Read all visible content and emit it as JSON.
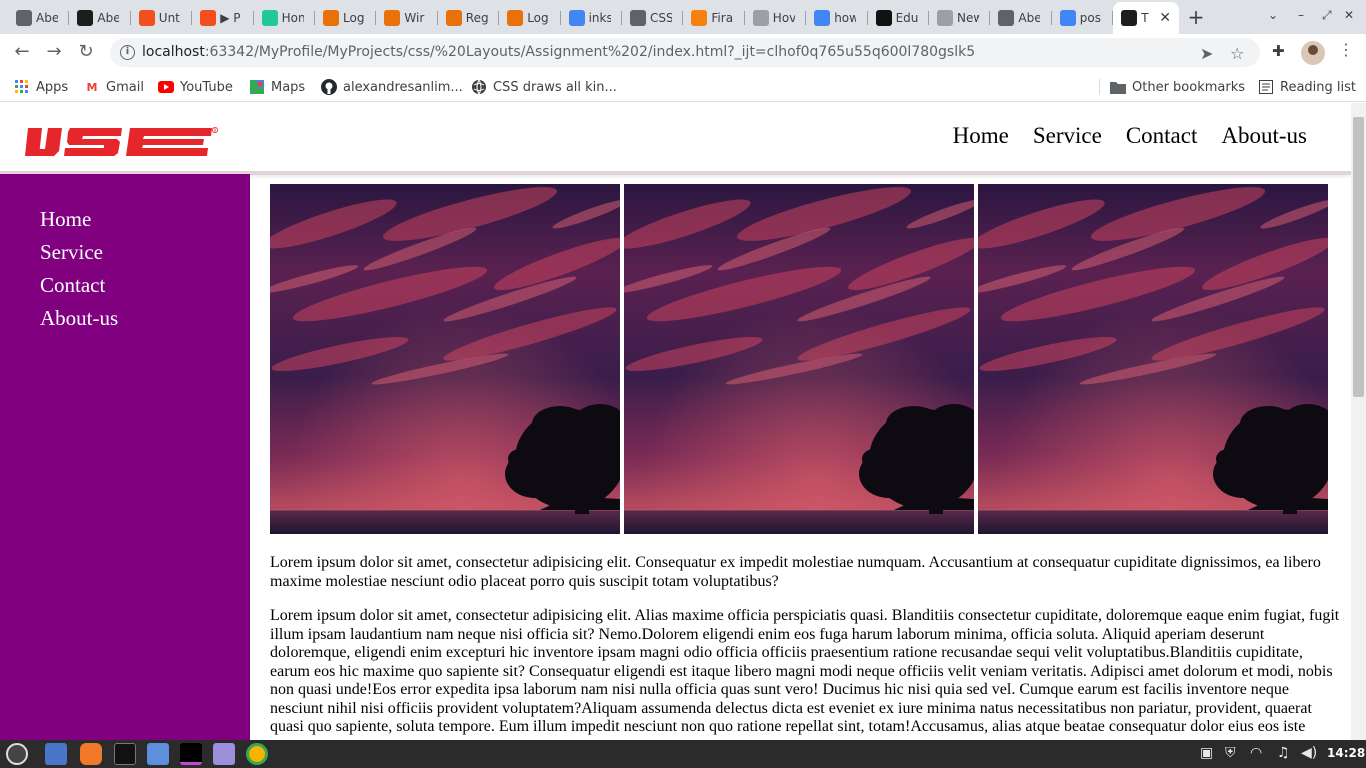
{
  "browser": {
    "tabs": [
      {
        "label": "Abe",
        "icon": "globe-icon",
        "color": "#5f6368"
      },
      {
        "label": "Abe",
        "icon": "intellij-icon",
        "color": "#1d1d1d"
      },
      {
        "label": "Unt",
        "icon": "figma-icon",
        "color": "#f24e1e"
      },
      {
        "label": "▶ P",
        "icon": "figma-icon",
        "color": "#f24e1e"
      },
      {
        "label": "Hon",
        "icon": "app-icon",
        "color": "#20c997"
      },
      {
        "label": "Log",
        "icon": "page-icon",
        "color": "#e8710a"
      },
      {
        "label": "Wir",
        "icon": "page-icon",
        "color": "#e8710a"
      },
      {
        "label": "Reg",
        "icon": "page-icon",
        "color": "#e8710a"
      },
      {
        "label": "Log",
        "icon": "page-icon",
        "color": "#e8710a"
      },
      {
        "label": "inks",
        "icon": "google-icon",
        "color": "#4285f4"
      },
      {
        "label": "CSS",
        "icon": "globe-icon",
        "color": "#5f6368"
      },
      {
        "label": "Fira",
        "icon": "firebase-icon",
        "color": "#f6820d"
      },
      {
        "label": "Hov",
        "icon": "code-icon",
        "color": "#9aa0a6"
      },
      {
        "label": "how",
        "icon": "google-icon",
        "color": "#4285f4"
      },
      {
        "label": "Edu",
        "icon": "unsplash-icon",
        "color": "#111111"
      },
      {
        "label": "New",
        "icon": "globe-icon",
        "color": "#9aa0a6"
      },
      {
        "label": "Abe",
        "icon": "globe-icon",
        "color": "#5f6368"
      },
      {
        "label": "pos",
        "icon": "google-icon",
        "color": "#4285f4"
      },
      {
        "label": "T",
        "icon": "intellij-icon",
        "color": "#1d1d1d",
        "active": true
      }
    ],
    "new_tab": "+",
    "close": "✕",
    "url_host": "localhost",
    "url_rest": ":63342/MyProfile/MyProjects/css/%20Layouts/Assignment%202/index.html?_ijt=clhof0q765u55q600l780gslk5",
    "bookmarks": [
      {
        "label": "Apps",
        "icon": "apps-grid-icon"
      },
      {
        "label": "Gmail",
        "icon": "gmail-icon"
      },
      {
        "label": "YouTube",
        "icon": "youtube-icon"
      },
      {
        "label": "Maps",
        "icon": "maps-icon"
      },
      {
        "label": "alexandresanlim...",
        "icon": "github-icon"
      },
      {
        "label": "CSS draws all kin...",
        "icon": "globe-icon"
      }
    ],
    "other_bookmarks": "Other bookmarks",
    "reading_list": "Reading list"
  },
  "site": {
    "logo_text": "IJSE",
    "brand_color": "#e5262a",
    "sidebar_color": "#800080",
    "nav": [
      "Home",
      "Service",
      "Contact",
      "About-us"
    ],
    "sidebar_nav": [
      "Home",
      "Service",
      "Contact",
      "About-us"
    ],
    "paragraphs": [
      "Lorem ipsum dolor sit amet, consectetur adipisicing elit. Consequatur ex impedit molestiae numquam. Accusantium at consequatur cupiditate dignissimos, ea libero maxime molestiae nesciunt odio placeat porro quis suscipit totam voluptatibus?",
      "Lorem ipsum dolor sit amet, consectetur adipisicing elit. Alias maxime officia perspiciatis quasi. Blanditiis consectetur cupiditate, doloremque eaque enim fugiat, fugit illum ipsam laudantium nam neque nisi officia sit? Nemo.Dolorem eligendi enim eos fuga harum laborum minima, officia soluta. Aliquid aperiam deserunt doloremque, eligendi enim excepturi hic inventore ipsam magni odio officia officiis praesentium ratione recusandae sequi velit voluptatibus.Blanditiis cupiditate, earum eos hic maxime quo sapiente sit? Consequatur eligendi est itaque libero magni modi neque officiis velit veniam veritatis. Adipisci amet dolorum et modi, nobis non quasi unde!Eos error expedita ipsa laborum nam nisi nulla officia quas sunt vero! Ducimus hic nisi quia sed vel. Cumque earum est facilis inventore neque nesciunt nihil nisi officiis provident voluptatem?Aliquam assumenda delectus dicta est eveniet ex iure minima natus necessitatibus non pariatur, provident, quaerat quasi quo sapiente, soluta tempore. Eum illum impedit nesciunt non quo ratione repellat sint, totam!Accusamus, alias atque beatae consequatur dolor eius eos iste"
    ]
  },
  "taskbar": {
    "clock": "14:28"
  }
}
